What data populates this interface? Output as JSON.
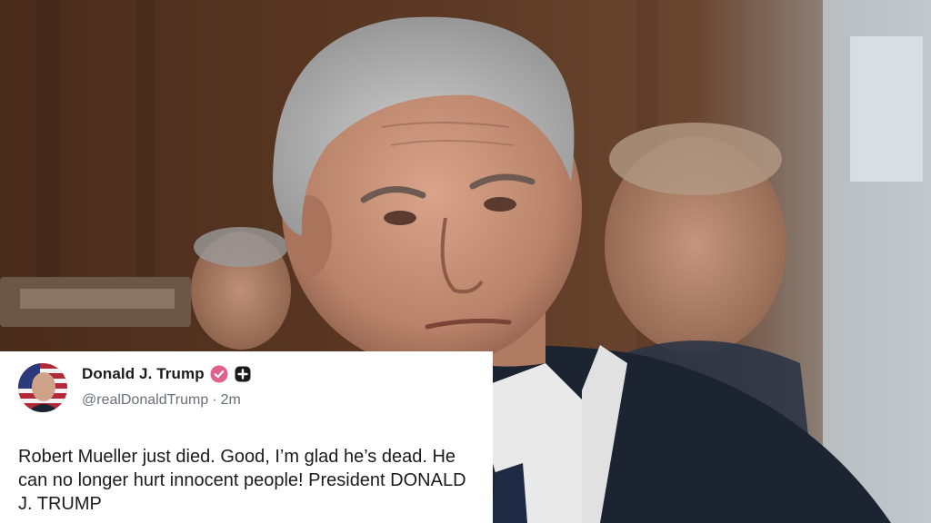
{
  "post": {
    "display_name": "Donald J. Trump",
    "handle": "@realDonaldTrump",
    "separator": "·",
    "time_ago": "2m",
    "text": "Robert Mueller just died. Good, I’m glad he’s dead. He can no longer hurt innocent people! President DONALD J. TRUMP"
  },
  "icons": {
    "verified": "verified-badge-icon",
    "follow": "plus-badge-icon"
  },
  "colors": {
    "verified_badge": "#e0608e",
    "follow_badge": "#1b1b1f",
    "card_background": "#ffffff",
    "handle_text": "#6a6f78"
  }
}
